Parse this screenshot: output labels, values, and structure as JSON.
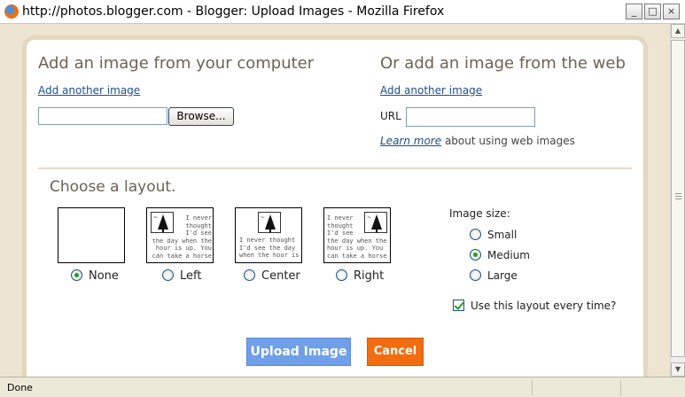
{
  "window": {
    "title": "http://photos.blogger.com - Blogger: Upload Images - Mozilla Firefox",
    "buttons": {
      "minimize": "_",
      "maximize": "□",
      "close": "×"
    }
  },
  "computer": {
    "heading": "Add an image from your computer",
    "add_another": "Add another image",
    "browse_label": "Browse...",
    "file_value": ""
  },
  "web": {
    "heading": "Or add an image from the web",
    "add_another": "Add another image",
    "url_label": "URL",
    "url_value": "",
    "learn_more": "Learn more",
    "learn_more_suffix": "about using web images"
  },
  "layout": {
    "heading": "Choose a layout.",
    "sample_text_left": "I never\nthought\nI'd see\nthe day when the\nhour is up. You\ncan take a horse",
    "sample_text_center": "I never thought\nI'd see the day\nwhen the hour is",
    "sample_text_right": "I never\nthought\nI'd see\nthe day when the\nhour is up. You\ncan take a horse",
    "options": [
      {
        "label": "None",
        "selected": true
      },
      {
        "label": "Left",
        "selected": false
      },
      {
        "label": "Center",
        "selected": false
      },
      {
        "label": "Right",
        "selected": false
      }
    ]
  },
  "image_size": {
    "heading": "Image size:",
    "options": [
      {
        "label": "Small",
        "selected": false
      },
      {
        "label": "Medium",
        "selected": true
      },
      {
        "label": "Large",
        "selected": false
      }
    ],
    "remember_label": "Use this layout every time?",
    "remember_checked": true
  },
  "actions": {
    "upload": "Upload Image",
    "cancel": "Cancel"
  },
  "status": {
    "text": "Done"
  },
  "colors": {
    "upload": "#6f9fe8",
    "cancel": "#f26c10",
    "heading": "#6e6252",
    "link": "#1c4e8e"
  }
}
